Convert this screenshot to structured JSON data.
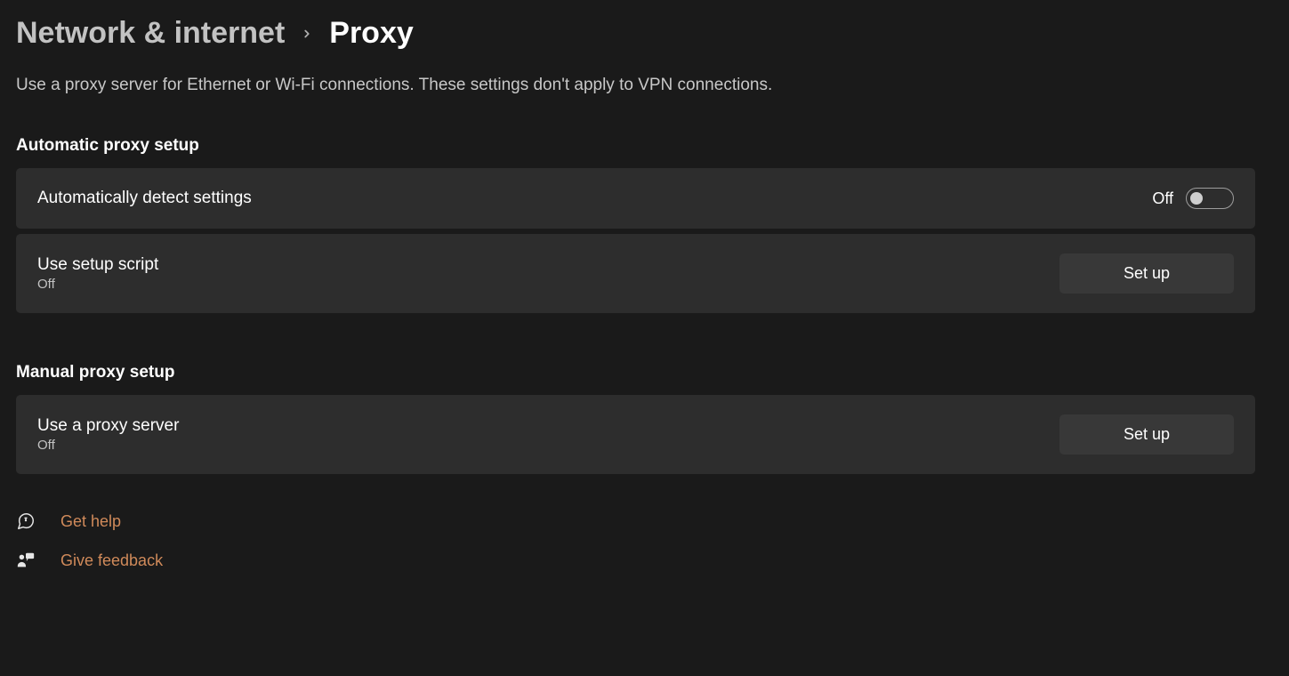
{
  "breadcrumb": {
    "parent": "Network & internet",
    "current": "Proxy"
  },
  "description": "Use a proxy server for Ethernet or Wi-Fi connections. These settings don't apply to VPN connections.",
  "sections": {
    "automatic": {
      "heading": "Automatic proxy setup",
      "auto_detect": {
        "title": "Automatically detect settings",
        "state_label": "Off"
      },
      "setup_script": {
        "title": "Use setup script",
        "sub": "Off",
        "button": "Set up"
      }
    },
    "manual": {
      "heading": "Manual proxy setup",
      "proxy_server": {
        "title": "Use a proxy server",
        "sub": "Off",
        "button": "Set up"
      }
    }
  },
  "footer": {
    "get_help": "Get help",
    "give_feedback": "Give feedback"
  }
}
